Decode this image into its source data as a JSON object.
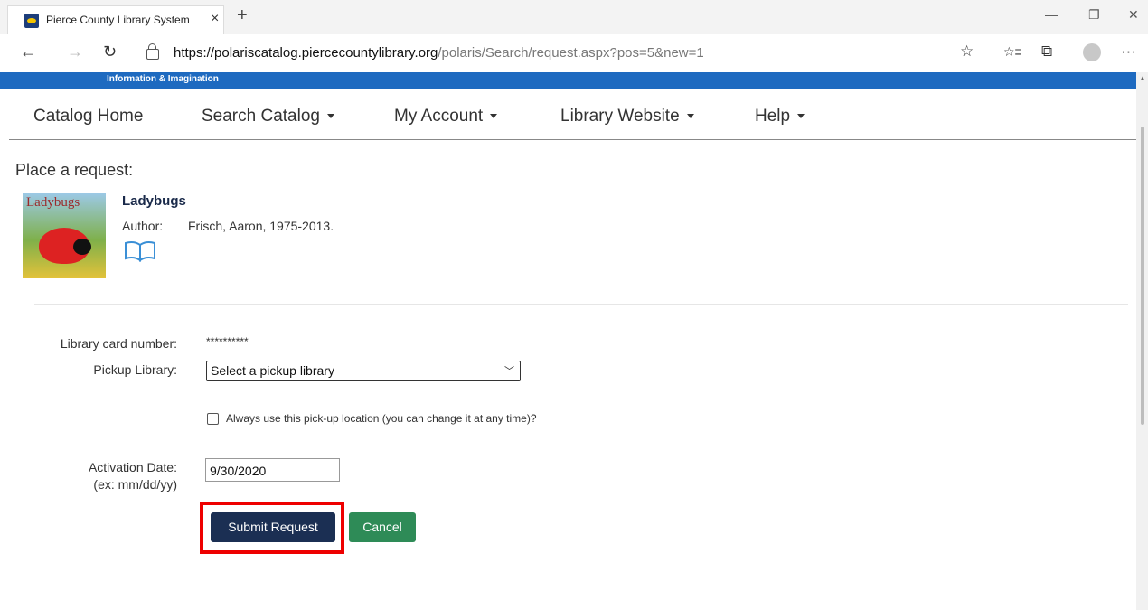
{
  "browser": {
    "tab_title": "Pierce County Library System",
    "tab_close": "×",
    "new_tab": "+",
    "url_host": "https://polariscatalog.piercecountylibrary.org",
    "url_path": "/polaris/Search/request.aspx?pos=5&new=1",
    "window_minimize": "—",
    "window_restore": "❐",
    "window_close": "✕",
    "back": "←",
    "forward": "→",
    "refresh": "↻",
    "favorite": "☆",
    "favorites": "☆≡",
    "collections": "⧉",
    "more": "···"
  },
  "banner": {
    "tagline": "Information & Imagination"
  },
  "nav": {
    "items": [
      {
        "label": "Catalog Home"
      },
      {
        "label": "Search Catalog"
      },
      {
        "label": "My Account"
      },
      {
        "label": "Library Website"
      },
      {
        "label": "Help"
      }
    ]
  },
  "page": {
    "heading": "Place a request:"
  },
  "item": {
    "cover_text": "Ladybugs",
    "title": "Ladybugs",
    "author_label": "Author:",
    "author": "Frisch, Aaron, 1975-2013."
  },
  "form": {
    "card_label": "Library card number:",
    "card_value": "**********",
    "pickup_label": "Pickup Library:",
    "pickup_selected": "Select a pickup library",
    "always_label": "Always use this pick-up location (you can change it at any time)?",
    "activation_label": "Activation Date:",
    "activation_hint": "(ex: mm/dd/yy)",
    "activation_value": "9/30/2020",
    "submit_label": "Submit Request",
    "cancel_label": "Cancel"
  },
  "colors": {
    "banner": "#1e6ac0",
    "submit_button": "#1b2f53",
    "cancel_button": "#2e8b57",
    "highlight": "#e00000"
  }
}
